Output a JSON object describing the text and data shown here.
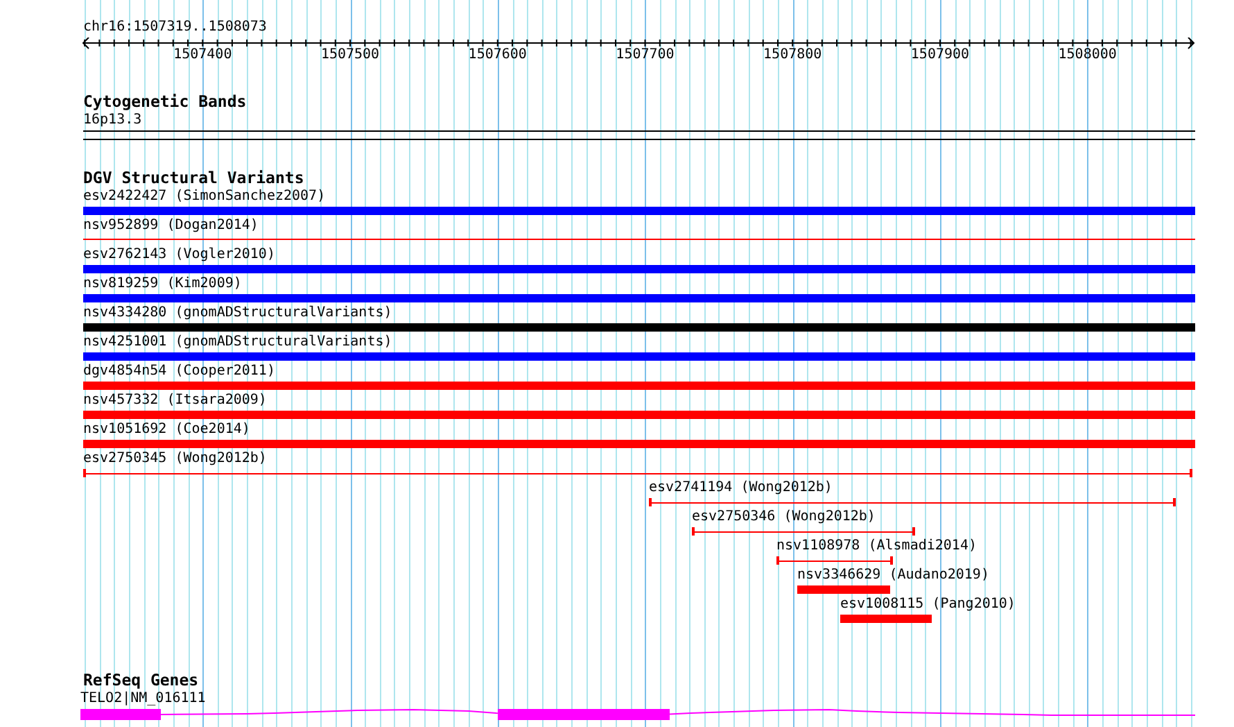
{
  "ruler": {
    "location": "chr16:1507319..1508073",
    "ticks": [
      "1507400",
      "1507500",
      "1507600",
      "1507700",
      "1507800",
      "1507900",
      "1508000"
    ]
  },
  "tracks": [
    {
      "title": "Cytogenetic Bands",
      "features": [
        {
          "label": "16p13.3",
          "kind": "band"
        }
      ]
    },
    {
      "title": "DGV Structural Variants",
      "features": [
        {
          "label": "esv2422427 (SimonSanchez2007)",
          "kind": "bar",
          "color": "#0000ff"
        },
        {
          "label": "nsv952899 (Dogan2014)",
          "kind": "line",
          "color": "#ff0000"
        },
        {
          "label": "esv2762143 (Vogler2010)",
          "kind": "bar",
          "color": "#0000ff"
        },
        {
          "label": "nsv819259 (Kim2009)",
          "kind": "bar",
          "color": "#0000ff"
        },
        {
          "label": "nsv4334280 (gnomADStructuralVariants)",
          "kind": "bar",
          "color": "#000000"
        },
        {
          "label": "nsv4251001 (gnomADStructuralVariants)",
          "kind": "bar",
          "color": "#0000ff"
        },
        {
          "label": "dgv4854n54 (Cooper2011)",
          "kind": "bar",
          "color": "#ff0000"
        },
        {
          "label": "nsv457332 (Itsara2009)",
          "kind": "bar",
          "color": "#ff0000"
        },
        {
          "label": "nsv1051692 (Coe2014)",
          "kind": "bar",
          "color": "#ff0000"
        },
        {
          "label": "esv2750345 (Wong2012b)",
          "kind": "span",
          "color": "#ff0000"
        },
        {
          "label": "esv2741194 (Wong2012b)",
          "kind": "span",
          "color": "#ff0000"
        },
        {
          "label": "esv2750346 (Wong2012b)",
          "kind": "span",
          "color": "#ff0000"
        },
        {
          "label": "nsv1108978 (Alsmadi2014)",
          "kind": "span",
          "color": "#ff0000"
        },
        {
          "label": "nsv3346629 (Audano2019)",
          "kind": "bar",
          "color": "#ff0000"
        },
        {
          "label": "esv1008115 (Pang2010)",
          "kind": "bar",
          "color": "#ff0000"
        }
      ]
    },
    {
      "title": "RefSeq Genes",
      "features": [
        {
          "label": "TELO2|NM_016111",
          "kind": "gene",
          "color": "#ff00ff"
        }
      ]
    }
  ]
}
